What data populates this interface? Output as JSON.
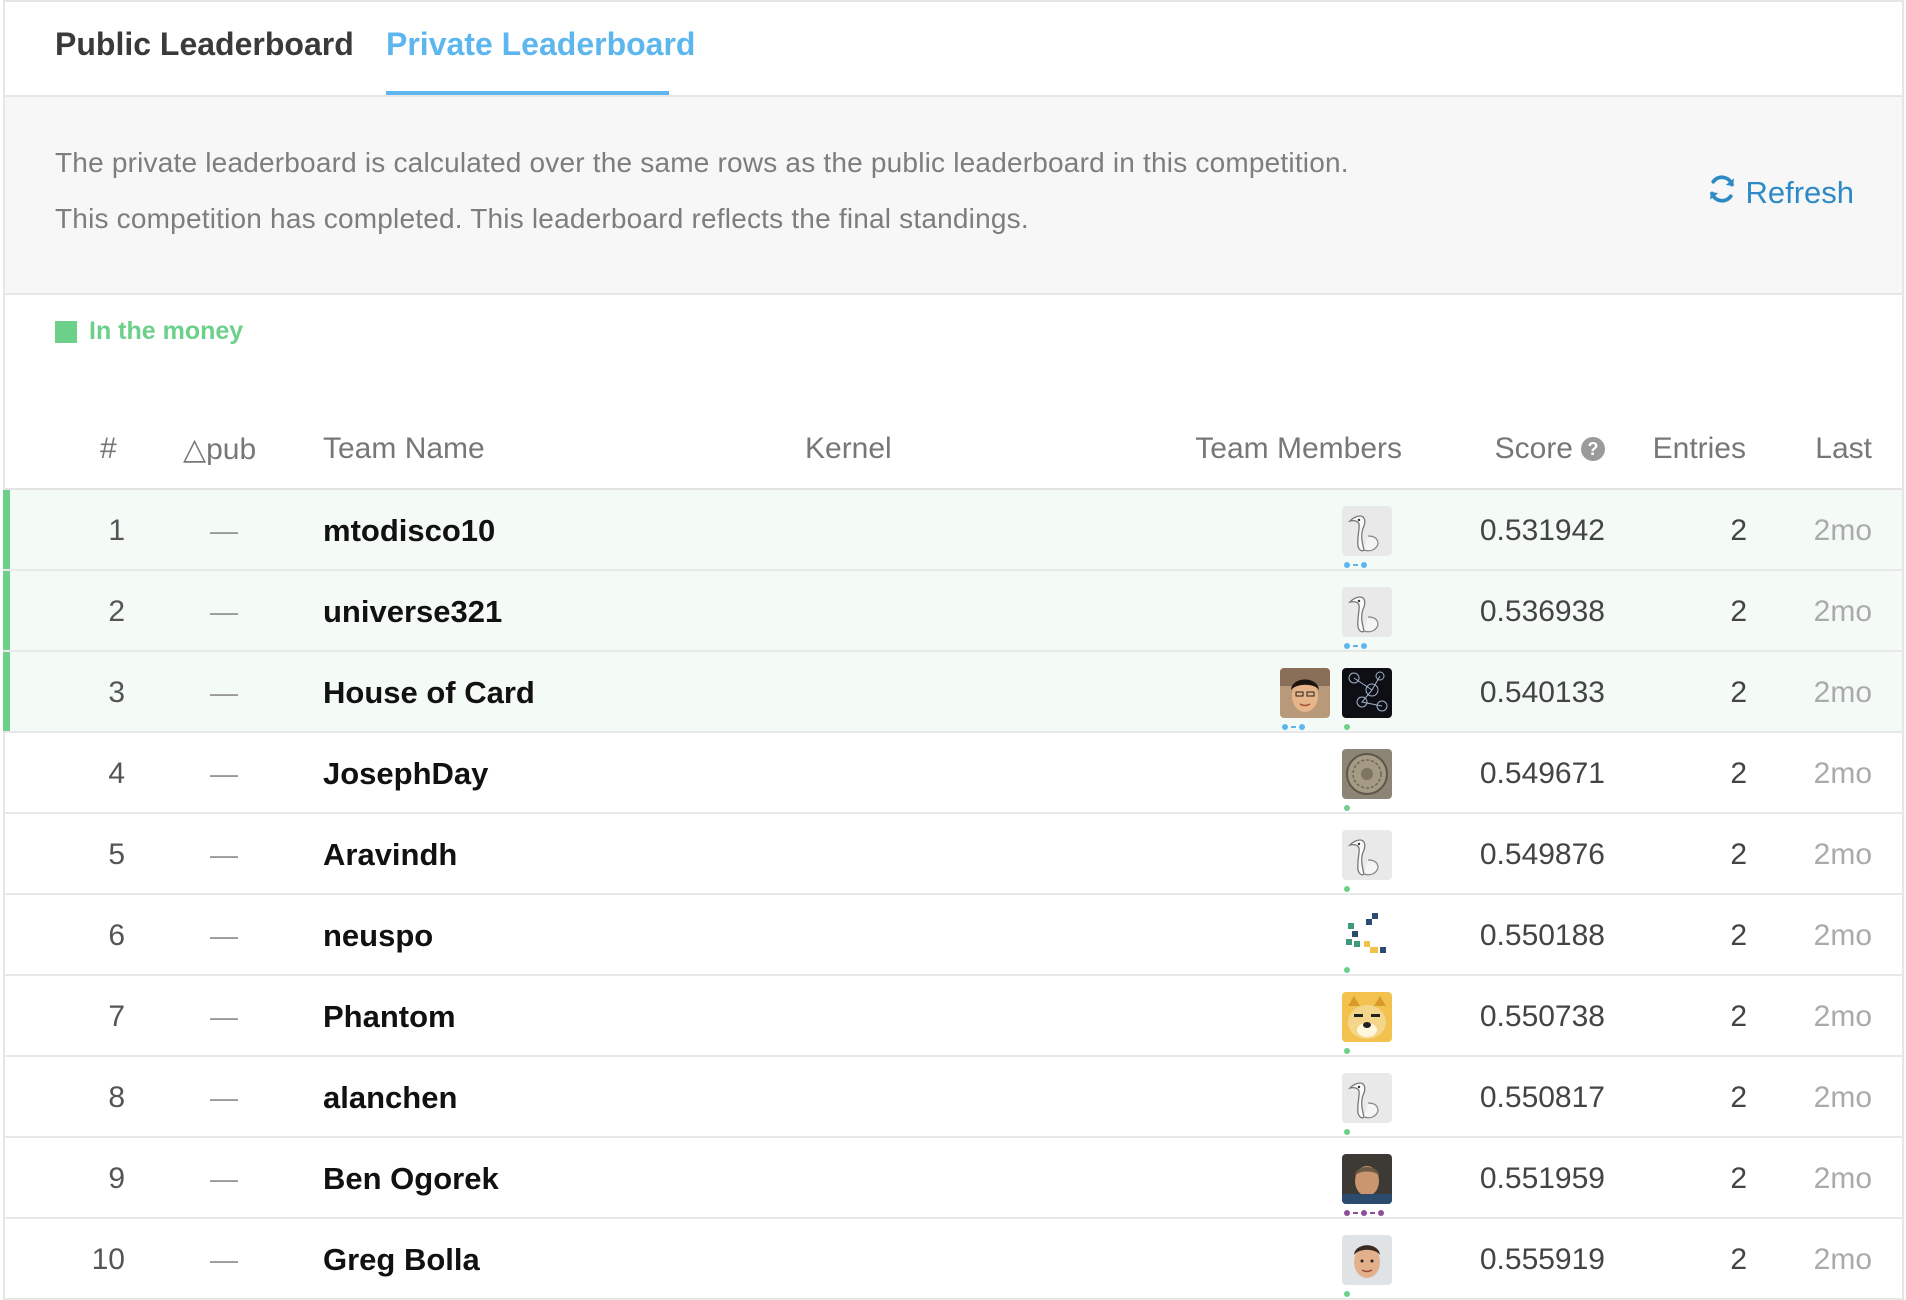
{
  "tabs": [
    {
      "label": "Public Leaderboard",
      "active": false
    },
    {
      "label": "Private Leaderboard",
      "active": true
    }
  ],
  "notice": {
    "line1": "The private leaderboard is calculated over the same rows as the public leaderboard in this competition.",
    "line2": "This competition has completed. This leaderboard reflects the final standings.",
    "refresh_label": "Refresh"
  },
  "legend": {
    "label": "In the money",
    "color": "#6cd08a"
  },
  "columns": {
    "rank": "#",
    "pub": "△pub",
    "team": "Team Name",
    "kernel": "Kernel",
    "members": "Team Members",
    "score": "Score",
    "entries": "Entries",
    "last": "Last"
  },
  "rows": [
    {
      "rank": "1",
      "delta": "—",
      "team": "mtodisco10",
      "score": "0.531942",
      "entries": "2",
      "last": "2mo",
      "in_money": true,
      "members": [
        {
          "avatar": "goose-avatar",
          "tier_color": "#5db7ee",
          "tier_dots": 2
        }
      ]
    },
    {
      "rank": "2",
      "delta": "—",
      "team": "universe321",
      "score": "0.536938",
      "entries": "2",
      "last": "2mo",
      "in_money": true,
      "members": [
        {
          "avatar": "goose-avatar",
          "tier_color": "#5db7ee",
          "tier_dots": 2
        }
      ]
    },
    {
      "rank": "3",
      "delta": "—",
      "team": "House of Card",
      "score": "0.540133",
      "entries": "2",
      "last": "2mo",
      "in_money": true,
      "members": [
        {
          "avatar": "photo-avatar",
          "tier_color": "#5db7ee",
          "tier_dots": 2
        },
        {
          "avatar": "network-avatar",
          "tier_color": "#6cd08a",
          "tier_dots": 1
        }
      ]
    },
    {
      "rank": "4",
      "delta": "—",
      "team": "JosephDay",
      "score": "0.549671",
      "entries": "2",
      "last": "2mo",
      "in_money": false,
      "members": [
        {
          "avatar": "coin-avatar",
          "tier_color": "#6cd08a",
          "tier_dots": 1
        }
      ]
    },
    {
      "rank": "5",
      "delta": "—",
      "team": "Aravindh",
      "score": "0.549876",
      "entries": "2",
      "last": "2mo",
      "in_money": false,
      "members": [
        {
          "avatar": "goose-avatar",
          "tier_color": "#6cd08a",
          "tier_dots": 1
        }
      ]
    },
    {
      "rank": "6",
      "delta": "—",
      "team": "neuspo",
      "score": "0.550188",
      "entries": "2",
      "last": "2mo",
      "in_money": false,
      "members": [
        {
          "avatar": "pixel-avatar",
          "tier_color": "#6cd08a",
          "tier_dots": 1
        }
      ]
    },
    {
      "rank": "7",
      "delta": "—",
      "team": "Phantom",
      "score": "0.550738",
      "entries": "2",
      "last": "2mo",
      "in_money": false,
      "members": [
        {
          "avatar": "doge-avatar",
          "tier_color": "#6cd08a",
          "tier_dots": 1
        }
      ]
    },
    {
      "rank": "8",
      "delta": "—",
      "team": "alanchen",
      "score": "0.550817",
      "entries": "2",
      "last": "2mo",
      "in_money": false,
      "members": [
        {
          "avatar": "goose-avatar",
          "tier_color": "#6cd08a",
          "tier_dots": 1
        }
      ]
    },
    {
      "rank": "9",
      "delta": "—",
      "team": "Ben Ogorek",
      "score": "0.551959",
      "entries": "2",
      "last": "2mo",
      "in_money": false,
      "members": [
        {
          "avatar": "photo-avatar-2",
          "tier_color": "#8e4f9a",
          "tier_dots": 3
        }
      ]
    },
    {
      "rank": "10",
      "delta": "—",
      "team": "Greg Bolla",
      "score": "0.555919",
      "entries": "2",
      "last": "2mo",
      "in_money": false,
      "members": [
        {
          "avatar": "photo-avatar-3",
          "tier_color": "#6cd08a",
          "tier_dots": 1
        }
      ]
    }
  ]
}
